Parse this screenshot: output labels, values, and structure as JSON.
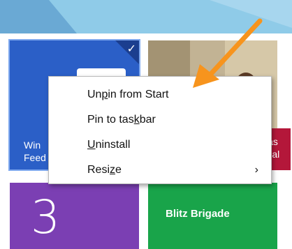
{
  "tiles": {
    "feedback": {
      "label_line1": "Win",
      "label_line2": "Feed"
    },
    "news": {
      "label_line1": "las",
      "label_line2": "Bal"
    },
    "calendar": {
      "number": "3"
    },
    "game": {
      "label": "Blitz Brigade"
    }
  },
  "context_menu": {
    "items": [
      {
        "before": "Un",
        "underline": "p",
        "after": "in from Start"
      },
      {
        "before": "Pin to tas",
        "underline": "k",
        "after": "bar"
      },
      {
        "before": "",
        "underline": "U",
        "after": "ninstall"
      },
      {
        "before": "Resi",
        "underline": "z",
        "after": "e",
        "chevron": "›"
      }
    ]
  },
  "icons": {
    "selected": "check-icon",
    "annotation": "orange-arrow-icon"
  },
  "colors": {
    "feedback_tile": "#2b5fc7",
    "calendar_tile": "#7b3fb3",
    "game_tile": "#19a44a",
    "news_tile": "#b4173a",
    "annotation_arrow": "#f7941d"
  }
}
